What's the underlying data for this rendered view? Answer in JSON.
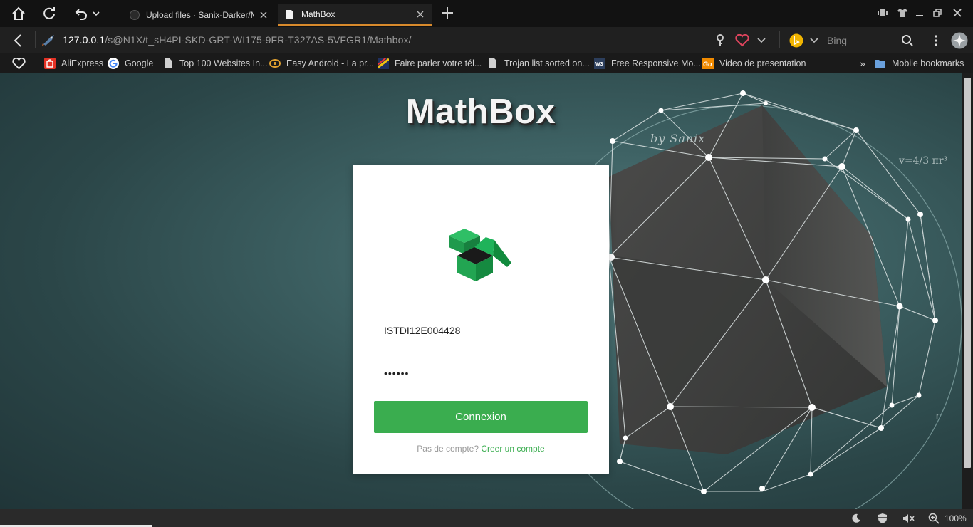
{
  "browser": {
    "tabs": [
      {
        "title": "Upload files · Sanix-Darker/M",
        "active": false
      },
      {
        "title": "MathBox",
        "active": true
      }
    ],
    "url": {
      "host": "127.0.0.1",
      "path": "/s@N1X/t_sH4PI-SKD-GRT-WI175-9FR-T327AS-5VFGR1/Mathbox/"
    },
    "search_engine": "Bing",
    "bookmarks": [
      {
        "label": "AliExpress",
        "icon": "aliexpress-icon"
      },
      {
        "label": "Google",
        "icon": "google-icon"
      },
      {
        "label": "Top 100 Websites In...",
        "icon": "page-icon"
      },
      {
        "label": "Easy Android - La pr...",
        "icon": "easy-android-icon"
      },
      {
        "label": "Faire parler votre tél...",
        "icon": "rainbow-icon"
      },
      {
        "label": "Trojan list sorted on...",
        "icon": "page-icon"
      },
      {
        "label": "Free Responsive Mo...",
        "icon": "w3-icon"
      },
      {
        "label": "Video de presentation",
        "icon": "go-icon"
      }
    ],
    "bookmarks_overflow": "»",
    "mobile_bookmarks": "Mobile bookmarks",
    "zoom": "100%"
  },
  "page": {
    "brand_title": "MathBox",
    "byline": "by Sanix",
    "formula": "v=4/3 πr³",
    "radius_label": "r",
    "login": {
      "username_value": "ISTDI12E004428",
      "password_masked": "••••••",
      "submit_label": "Connexion",
      "signup_prompt": "Pas de compte?",
      "signup_link": "Creer un compte"
    }
  },
  "colors": {
    "accent_green": "#3aad4f",
    "tab_underline": "#d88a2c"
  }
}
